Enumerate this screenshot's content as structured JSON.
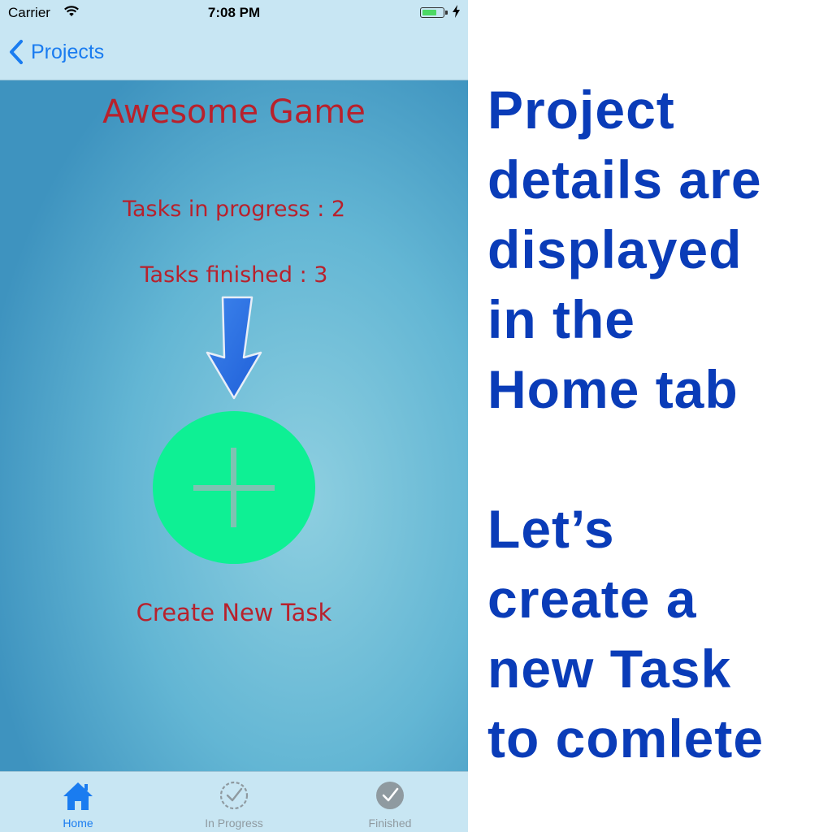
{
  "status_bar": {
    "carrier": "Carrier",
    "time": "7:08 PM",
    "battery_level": 0.75,
    "battery_color": "#4cd964"
  },
  "nav": {
    "back_label": "Projects",
    "back_icon": "chevron-left-icon",
    "accent": "#1a7cf0"
  },
  "project": {
    "title": "Awesome Game",
    "in_progress_text": "Tasks in progress : 2",
    "finished_text": "Tasks finished : 3",
    "create_label": "Create New Task",
    "text_color": "#b8212c",
    "add_button_color": "#0ef094"
  },
  "tabs": [
    {
      "label": "Home",
      "icon": "house-icon",
      "selected": true
    },
    {
      "label": "In Progress",
      "icon": "dashed-check-circle-icon",
      "selected": false
    },
    {
      "label": "Finished",
      "icon": "check-circle-icon",
      "selected": false
    }
  ],
  "caption": {
    "line1": "Project",
    "line2": "details are",
    "line3": "displayed",
    "line4": "in the",
    "line5": "Home tab",
    "line6": "Let’s",
    "line7": "create a",
    "line8": "new Task",
    "line9": "to comlete",
    "color": "#0a3cb8"
  }
}
